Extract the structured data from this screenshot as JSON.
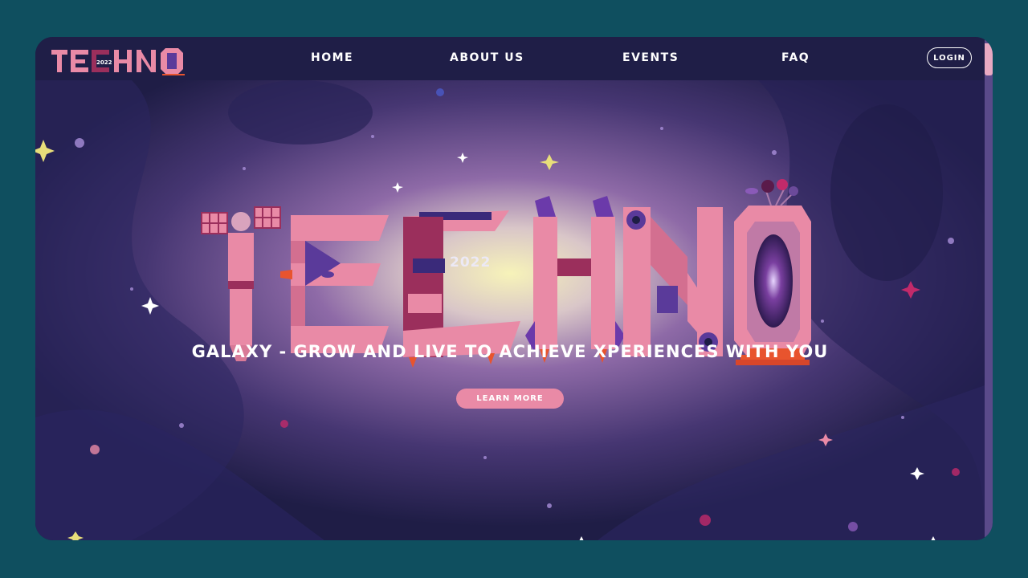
{
  "nav": {
    "logo_text": "TECHNO",
    "logo_year": "2022",
    "links": [
      {
        "label": "HOME"
      },
      {
        "label": "ABOUT US"
      },
      {
        "label": "EVENTS"
      },
      {
        "label": "FAQ"
      }
    ],
    "login_label": "LOGIN"
  },
  "hero": {
    "title_art": "TECHNO",
    "year": "2022",
    "headline": "GALAXY - GROW AND LIVE TO ACHIEVE XPERIENCES WITH YOU",
    "cta_label": "LEARN MORE"
  },
  "colors": {
    "page_background": "#0f4f5f",
    "nav_background": "#1f1e47",
    "space_dark": "#1e1d45",
    "nebula_purple": "#6b4a9a",
    "glow_yellow": "#f4efb0",
    "letter_pink": "#e98aa6",
    "letter_dark": "#9b2f5c",
    "accent_orange": "#e8542e",
    "cta_pink": "#e98aa6",
    "scroll_thumb": "#e8a9c2"
  },
  "icons": [
    "star-icon",
    "satellite-icon",
    "rocket-icon",
    "planet-icon",
    "portal-icon"
  ]
}
